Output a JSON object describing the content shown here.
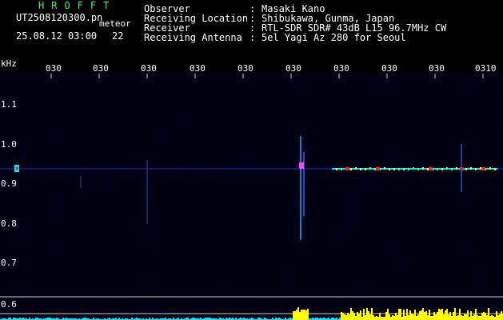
{
  "header": {
    "app_title": "HROFFT",
    "filename": "UT2508120300.pn",
    "meteor_label": "meteor",
    "datetime": "25.08.12 03:00",
    "meteor_count": "22"
  },
  "info": [
    {
      "label": "Observer",
      "value": "Masaki Kano"
    },
    {
      "label": "Receiving Location",
      "value": "Shibukawa, Gunma, Japan"
    },
    {
      "label": "Receiver",
      "value": "RTL-SDR SDR# 43dB L15 96.7MHz CW"
    },
    {
      "label": "Receiving Antenna",
      "value": "5el Yagi Az 280 for Seoul"
    }
  ],
  "axis": {
    "unit_label": "kHz",
    "time_ticks": [
      "030",
      "030",
      "030",
      "030",
      "030",
      "030",
      "030",
      "030",
      "030",
      "0310"
    ],
    "freq_ticks": [
      "1.1",
      "1.0",
      "0.9",
      "0.8",
      "0.7",
      "0.6"
    ]
  },
  "colors": {
    "header_green": "#33ff33",
    "text_white": "#ffffff",
    "trace_cyan": "#00e5ff",
    "signal_yellow": "#ffff00",
    "signal_red": "#ff2020",
    "background_blue": "#000030"
  }
}
